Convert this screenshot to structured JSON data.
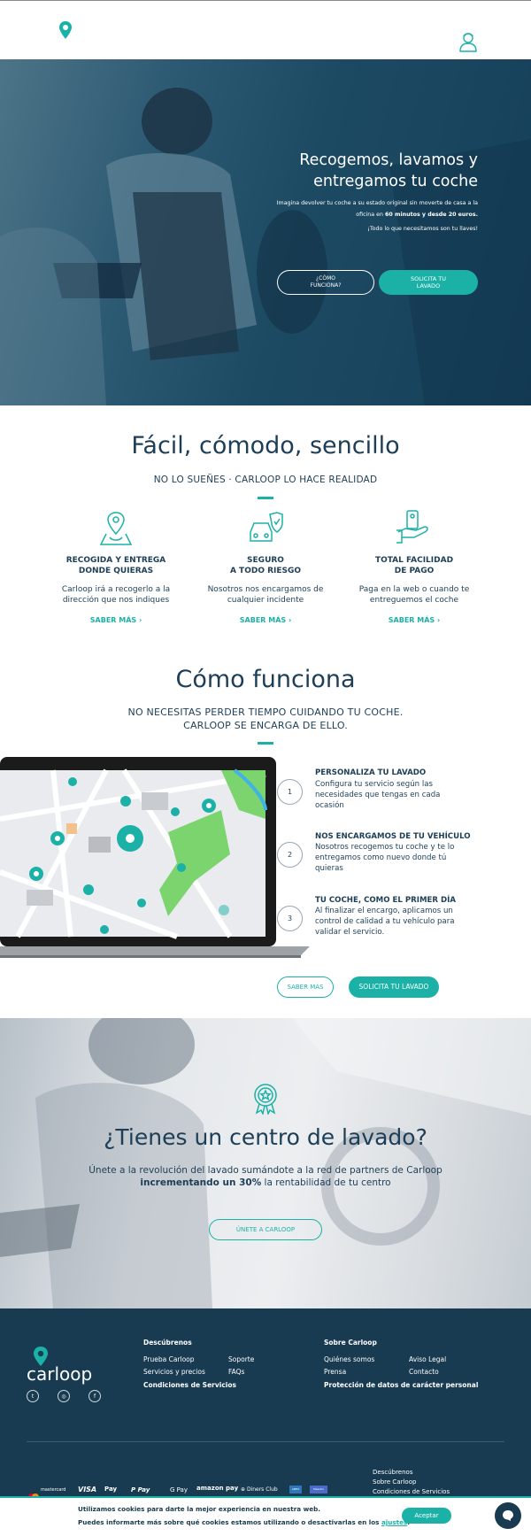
{
  "header": {
    "logo_icon": "location-pin-icon",
    "account_icon": "user-avatar-icon"
  },
  "hero": {
    "title_line1": "Recogemos, lavamos y",
    "title_line2": "entregamos tu coche",
    "text_line1": "Imagina devolver tu coche a su estado original sin moverte de casa a la",
    "text_line2_a": "oficina en ",
    "text_line2_b": "60 minutos y desde 20 euros.",
    "text_line3": "¡Todo lo que necesitamos son tu llaves!",
    "btn_how_line1": "¿CÓMO",
    "btn_how_line2": "FUNCIONA?",
    "btn_request_line1": "SOLICITA TU",
    "btn_request_line2": "LAVADO"
  },
  "easy": {
    "title": "Fácil, cómodo, sencillo",
    "subtitle": "NO LO SUEÑES · CARLOOP LO HACE REALIDAD",
    "features": [
      {
        "icon": "pickup-location-icon",
        "title1": "RECOGIDA Y ENTREGA",
        "title2": "DONDE QUIERAS",
        "text1": "Carloop irá a recogerlo a la",
        "text2": "dirección que nos indiques",
        "more": "SABER MÁS"
      },
      {
        "icon": "insured-car-icon",
        "title1": "SEGURO",
        "title2": "A TODO RIESGO",
        "text1": "Nosotros nos encargamos de",
        "text2": "cualquier incidente",
        "more": "SABER MÁS"
      },
      {
        "icon": "payment-hand-icon",
        "title1": "TOTAL FACILIDAD",
        "title2": "DE PAGO",
        "text1": "Paga en la web o cuando te",
        "text2": "entreguemos el coche",
        "more": "SABER MÁS"
      }
    ]
  },
  "how": {
    "title": "Cómo funciona",
    "subtitle_line1": "NO NECESITAS PERDER TIEMPO CUIDANDO TU COCHE.",
    "subtitle_line2": "CARLOOP SE ENCARGA DE ELLO.",
    "steps": [
      {
        "num": "1",
        "title": "PERSONALIZA TU LAVADO",
        "lines": [
          "Configura tu servicio según las",
          "necesidades que tengas en cada",
          "ocasión"
        ]
      },
      {
        "num": "2",
        "title": "NOS ENCARGAMOS DE TU VEHÍCULO",
        "lines": [
          "Nosotros recogemos tu coche y te lo",
          "entregamos como nuevo donde tú",
          "quieras"
        ]
      },
      {
        "num": "3",
        "title": "TU COCHE, COMO EL PRIMER DÍA",
        "lines": [
          "Al finalizar el encargo, aplicamos un",
          "control de calidad a tu vehículo para",
          "validar el servicio."
        ]
      }
    ],
    "btn_more": "SABER MÁS",
    "btn_request": "SOLICITA TU LAVADO"
  },
  "partners": {
    "icon": "badge-star-icon",
    "title": "¿Tienes un centro de lavado?",
    "text_line1": "Únete a la revolución del lavado sumándote a la red de partners de Carloop",
    "text_line2_b": "incrementando un 30%",
    "text_line2_rest": " la rentabilidad de tu centro",
    "btn": "ÚNETE A CARLOOP"
  },
  "footer": {
    "logo_text": "carloop",
    "col1_head": "Descúbrenos",
    "col1_links": [
      "Prueba Carloop",
      "Servicios y precios",
      "Condiciones de Servicios"
    ],
    "col1b_links": [
      "Soporte",
      "FAQs"
    ],
    "col2_head": "Sobre Carloop",
    "col2_links": [
      "Quiénes somos",
      "Prensa",
      "Protección de datos de carácter personal"
    ],
    "col2b_links": [
      "Aviso Legal",
      "Contacto"
    ],
    "social": [
      "twitter-icon",
      "instagram-icon",
      "facebook-icon"
    ],
    "payments": [
      "mastercard",
      "VISA",
      "Pay",
      "Pay",
      "G Pay",
      "amazon pay",
      "Diners Club",
      "AMEX",
      "Maestro"
    ],
    "bottom_links": [
      "Descúbrenos",
      "Sobre Carloop",
      "Condiciones de Servicios"
    ]
  },
  "cookie": {
    "line1": "Utilizamos cookies para darte la mejor experiencia en nuestra web.",
    "line2_pre": "Puedes informarte más sobre qué cookies estamos utilizando o desactivarlas en los ",
    "line2_link": "ajustes",
    "line2_post": ".",
    "accept": "Aceptar",
    "chat_icon": "chat-bubble-icon"
  },
  "colors": {
    "teal": "#1cb1a6",
    "navy": "#183b52",
    "text": "#1d3e57"
  }
}
